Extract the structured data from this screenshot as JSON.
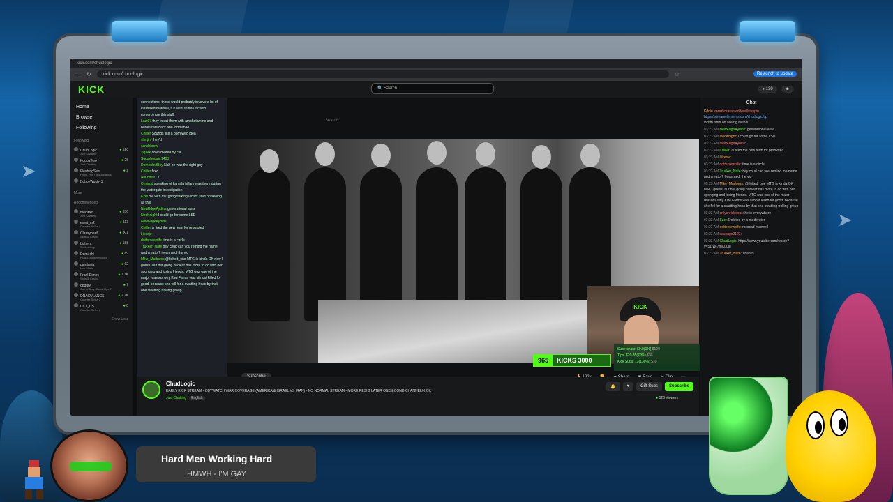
{
  "browser": {
    "url": "kick.com/chudlogic",
    "relaunch": "Relaunch to update",
    "bookmarks": [
      "Facebook",
      "Twitter",
      "YouTube",
      "YouTube TV",
      "Discord",
      "Kick",
      "UFC",
      "NBA",
      "NBA Trade Machine",
      "ESPN",
      "DraftKings",
      "Spectrum",
      "Kiwi Farms",
      "Cranz Kyrell",
      "Disney+",
      "Netflix",
      "Hulu",
      "Max",
      "Bank of America",
      "Microsoft account",
      "Amazon",
      "Amazon Music",
      "Fudge",
      "ESD Maps"
    ]
  },
  "kick": {
    "logo": "KICK",
    "search_placeholder": "Search",
    "kicks_balance": "139"
  },
  "sidebar": {
    "nav": [
      "Home",
      "Browse",
      "Following"
    ],
    "following_title": "Following",
    "following": [
      {
        "name": "ChudLogic",
        "sub": "Just Chatting",
        "count": "526"
      },
      {
        "name": "KoopaTwo",
        "sub": "Just Chatting",
        "count": "25"
      },
      {
        "name": "FleshingSeal",
        "sub": "Pools, Hot Tubs & Bikinis",
        "count": "1"
      },
      {
        "name": "BobbyWubby1",
        "sub": "",
        "count": ""
      }
    ],
    "more": "More",
    "recommended_title": "Recommended",
    "recommended": [
      {
        "name": "meowko",
        "sub": "Just Chatting",
        "count": "656"
      },
      {
        "name": "exert_m2",
        "sub": "Counter-Strike 2",
        "count": "113"
      },
      {
        "name": "Classybeef",
        "sub": "Slots & Casino",
        "count": "801"
      },
      {
        "name": "Lishera",
        "sub": "Satisfactory",
        "count": "188"
      },
      {
        "name": "Damuchi",
        "sub": "PUBG: Battlegrounds",
        "count": "89"
      },
      {
        "name": "pantiania",
        "sub": "Live Music",
        "count": "62"
      },
      {
        "name": "FrankDimes",
        "sub": "Slots & Casino",
        "count": "1.1K"
      },
      {
        "name": "dbduty",
        "sub": "Call of Duty: Black Ops 7",
        "count": "7"
      },
      {
        "name": "DRACULANCS",
        "sub": "Counter-Strike 2",
        "count": "2.7K"
      },
      {
        "name": "CCT_CS",
        "sub": "Counter-Strike 2",
        "count": "8"
      }
    ],
    "show_less": "Show Less"
  },
  "overlay_chat": [
    {
      "u": "",
      "m": "connections, these would probably involve a lot of classified material, if it went to trail it could compromise this stuff."
    },
    {
      "u": "Lazt97",
      "m": "they inject them with amphetamine and barbiturate back and forth lmao"
    },
    {
      "u": "Chiller",
      "m": "Sounds like a borrowed idea"
    },
    {
      "u": "slimjim",
      "m": "they'd"
    },
    {
      "u": "sandshrew",
      "m": ""
    },
    {
      "u": "zigzak",
      "m": "brain melted by cia"
    },
    {
      "u": "Sugarbooger1488",
      "m": ""
    },
    {
      "u": "DementedBoy",
      "m": "Nah he was the right guy"
    },
    {
      "u": "Chiller",
      "m": "fired"
    },
    {
      "u": "Anubite",
      "m": "LOL"
    },
    {
      "u": "Omaidd",
      "m": "speaking of kamala hillary was there during the watergate investigation"
    },
    {
      "u": "Ezel",
      "m": "me with my 'gangstalking victim' shirt on seeing all this"
    },
    {
      "u": "NewEdgeAydins",
      "m": "generational aura"
    },
    {
      "u": "NeoKnight",
      "m": "I could go for some LSD"
    },
    {
      "u": "NewEdgeAydins",
      "m": ""
    },
    {
      "u": "Chiller",
      "m": "is fired the new term for promoted"
    },
    {
      "u": "Likesje",
      "m": ""
    },
    {
      "u": "dottersewolfe",
      "m": "time is a circle"
    },
    {
      "u": "Trucker_Nate",
      "m": "hey chud can you remind me name and creator? i wanna di the vid"
    },
    {
      "u": "Mike_Madness",
      "m": "@fielted_one MTG is kinda OK now I guess, but her going nuclear has more to do with her sponging and losing friends. MTG was one of the major reasons why Kiwi Farms was almost killed for good, because she fell for a swatting hoax by that one swatting trolling group"
    }
  ],
  "player": {
    "search": "Search",
    "subscribe": "Subscribe",
    "likes": "122k",
    "share": "Share",
    "save": "Save",
    "clip": "Clip",
    "webcam_cap": "KICK"
  },
  "goal": {
    "count": "965",
    "label": "KICKS 3000"
  },
  "supercard": {
    "line1": "Superchats: $0.0(0%)",
    "line1_goal": "$100",
    "line2": "Tips: $20.85(70%)",
    "line2_goal": "$30",
    "line3": "Kick Subs: 13(130%)",
    "line3_goal": "$10"
  },
  "stream": {
    "name": "ChudLogic",
    "title": "EARLY KICK STREAM - ODYWATCH WAR COVERAGE (AMERICA & ISRAEL VS IRAN) - NO NORMAL STREAM - MORE RESI 9 LATER ON SECOND CHANNEL/KICK",
    "category": "Just Chatting",
    "language": "English",
    "gift": "Gift Subs",
    "subscribe": "Subscribe",
    "viewers": "526 Viewers"
  },
  "chat": {
    "title": "Chat",
    "pinned_user": "Eddie",
    "pinned_names": [
      "swordicsarah",
      "adderallsteppin"
    ],
    "pinned_link": "https://streamelements.com/chudlogic/tip",
    "messages": [
      {
        "t": "",
        "u": "",
        "m": "victim' shirt on seeing all this"
      },
      {
        "t": "03:23 AM",
        "u": "NewEdgeAydins",
        "m": "generational aura"
      },
      {
        "t": "03:23 AM",
        "u": "NeoKnight",
        "m": "I could go for some LSD"
      },
      {
        "t": "03:23 AM",
        "u": "NewEdgeAydins",
        "m": ""
      },
      {
        "t": "03:23 AM",
        "u": "Chiller",
        "m": "is fired the new term for promoted"
      },
      {
        "t": "03:23 AM",
        "u": "Likesje",
        "m": ""
      },
      {
        "t": "03:23 AM",
        "u": "dottersewolfe",
        "m": "time is a circle"
      },
      {
        "t": "03:23 AM",
        "u": "Trucker_Nate",
        "m": "hey chud can you remind me name and creator? I wanna di the vid"
      },
      {
        "t": "03:23 AM",
        "u": "Mike_Madness",
        "m": "@fielted_one MTG is kinda OK now I guess, but her going nuclear has more to do with her sponging and losing friends. MTG was one of the major reasons why Kiwi Farms was almost killed for good, because she fell for a swatting hoax by that one swatting trolling group"
      },
      {
        "t": "03:23 AM",
        "u": "onlychrisbooks",
        "m": "he is everywhere"
      },
      {
        "t": "03:23 AM",
        "u": "Ezel",
        "m": "Deleted by a moderator"
      },
      {
        "t": "03:23 AM",
        "u": "dottersewolfe",
        "m": "mossad maxwell"
      },
      {
        "t": "03:23 AM",
        "u": "sausage2123",
        "m": ""
      },
      {
        "t": "03:23 AM",
        "u": "ChudLogic",
        "m": "https://www.youtube.com/watch?v=SDW-7mCuuig"
      },
      {
        "t": "03:23 AM",
        "u": "Trucker_Nate",
        "m": "Thanks"
      }
    ]
  },
  "now_playing": {
    "title": "Hard Men Working Hard",
    "artist": "HMWH - I'M GAY"
  },
  "colors": {
    "kick_green": "#53fc18"
  }
}
